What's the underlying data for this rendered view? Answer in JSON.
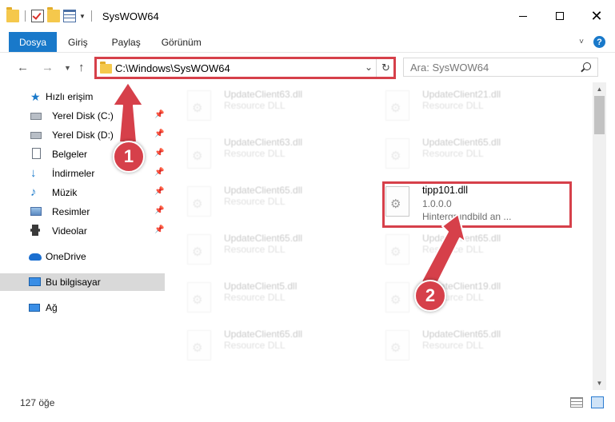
{
  "window": {
    "title": "SysWOW64",
    "minimize": "─",
    "maximize": "☐",
    "close": "✕"
  },
  "ribbon": {
    "tabs": [
      "Dosya",
      "Giriş",
      "Paylaş",
      "Görünüm"
    ],
    "accent_color": "#1979ca",
    "help": "?"
  },
  "address": {
    "path": "C:\\Windows\\SysWOW64",
    "search_placeholder": "Ara: SysWOW64"
  },
  "nav": {
    "quick_access": "Hızlı erişim",
    "items": [
      {
        "label": "Yerel Disk (C:)",
        "icon": "drive-icon",
        "pinned": true
      },
      {
        "label": "Yerel Disk (D:)",
        "icon": "drive-icon",
        "pinned": true
      },
      {
        "label": "Belgeler",
        "icon": "documents-icon",
        "pinned": true
      },
      {
        "label": "İndirmeler",
        "icon": "downloads-icon",
        "pinned": true
      },
      {
        "label": "Müzik",
        "icon": "music-icon",
        "pinned": true
      },
      {
        "label": "Resimler",
        "icon": "pictures-icon",
        "pinned": true
      },
      {
        "label": "Videolar",
        "icon": "videos-icon",
        "pinned": true
      }
    ],
    "onedrive": "OneDrive",
    "this_pc": "Bu bilgisayar",
    "network": "Ağ"
  },
  "files": [
    {
      "name": "UpdateClient63.dll",
      "sub": "Resource DLL"
    },
    {
      "name": "UpdateClient21.dll",
      "sub": "Resource DLL"
    },
    {
      "name": "UpdateClient63.dll",
      "sub": "Resource DLL"
    },
    {
      "name": "UpdateClient65.dll",
      "sub": "Resource DLL"
    },
    {
      "name": "UpdateClient65.dll",
      "sub": "Resource DLL"
    },
    {
      "name": "UpdateClient65.dll",
      "sub": "Resource DLL"
    },
    {
      "name": "UpdateClient65.dll",
      "sub": "Resource DLL"
    },
    {
      "name": "UpdateClient5.dll",
      "sub": "Resource DLL"
    },
    {
      "name": "UpdateClient19.dll",
      "sub": "Resource DLL"
    },
    {
      "name": "UpdateClient65.dll",
      "sub": "Resource DLL"
    },
    {
      "name": "UpdateClient65.dll",
      "sub": "Resource DLL"
    }
  ],
  "highlighted_file": {
    "name": "tipp101.dll",
    "version": "1.0.0.0",
    "description": "Hintergrundbild an ..."
  },
  "status": {
    "item_count": "127 öğe"
  },
  "annotations": {
    "step1": "1",
    "step2": "2",
    "color": "#d6404a"
  }
}
